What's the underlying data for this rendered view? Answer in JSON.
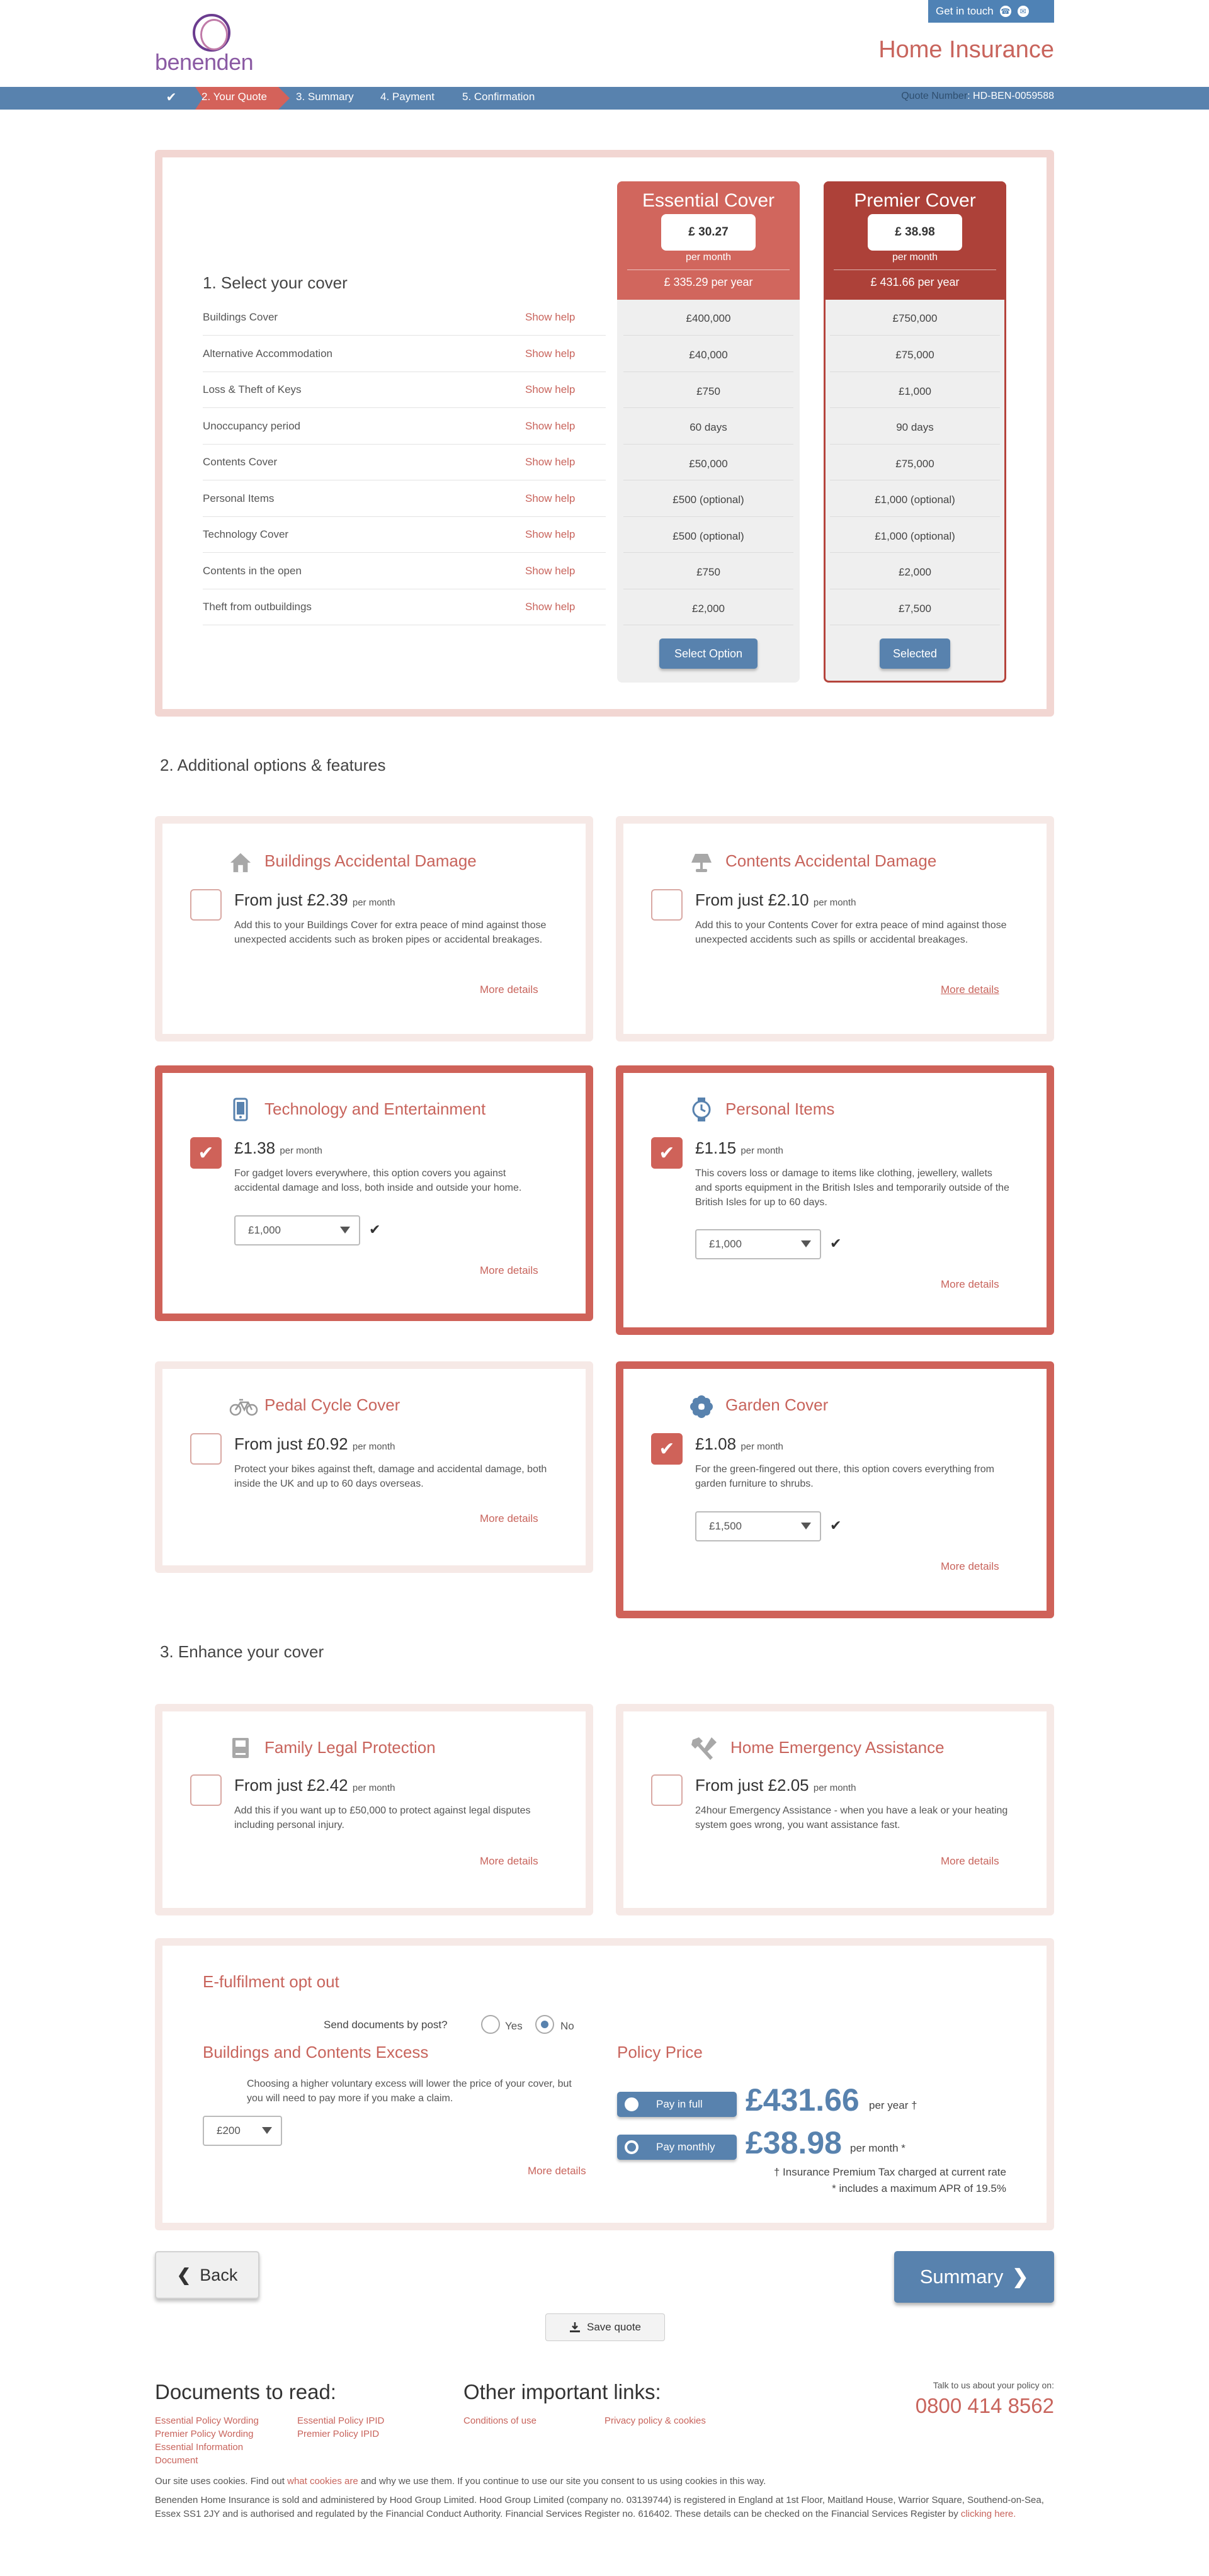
{
  "header": {
    "logo_text": "benenden",
    "get_in_touch": "Get in touch",
    "page_title": "Home Insurance",
    "steps": [
      "2. Your Quote",
      "3. Summary",
      "4. Payment",
      "5. Confirmation"
    ],
    "quote_number_label": "Quote Number",
    "quote_number": "HD-BEN-0059588"
  },
  "cover": {
    "section_title": "1. Select your cover",
    "rows": [
      {
        "label": "Buildings Cover",
        "help": "Show help",
        "essential": "£400,000",
        "premier": "£750,000"
      },
      {
        "label": "Alternative Accommodation",
        "help": "Show help",
        "essential": "£40,000",
        "premier": "£75,000"
      },
      {
        "label": "Loss & Theft of Keys",
        "help": "Show help",
        "essential": "£750",
        "premier": "£1,000"
      },
      {
        "label": "Unoccupancy period",
        "help": "Show help",
        "essential": "60 days",
        "premier": "90 days"
      },
      {
        "label": "Contents Cover",
        "help": "Show help",
        "essential": "£50,000",
        "premier": "£75,000"
      },
      {
        "label": "Personal Items",
        "help": "Show help",
        "essential": "£500 (optional)",
        "premier": "£1,000 (optional)"
      },
      {
        "label": "Technology Cover",
        "help": "Show help",
        "essential": "£500 (optional)",
        "premier": "£1,000 (optional)"
      },
      {
        "label": "Contents in the open",
        "help": "Show help",
        "essential": "£750",
        "premier": "£2,000"
      },
      {
        "label": "Theft from outbuildings",
        "help": "Show help",
        "essential": "£2,000",
        "premier": "£7,500"
      }
    ],
    "essential": {
      "title": "Essential Cover",
      "monthly": "£ 30.27",
      "per_month": "per month",
      "yearly": "£ 335.29  per year",
      "button": "Select Option"
    },
    "premier": {
      "title": "Premier Cover",
      "monthly": "£ 38.98",
      "per_month": "per month",
      "yearly": "£ 431.66  per year",
      "button": "Selected"
    }
  },
  "additional": {
    "section_title": "2. Additional options & features",
    "cards": [
      {
        "title": "Buildings Accidental Damage",
        "icon": "house-icon",
        "price": "From just £2.39",
        "per": "per month",
        "desc": "Add this to your Buildings Cover for extra peace of mind against those unexpected accidents such as broken pipes or accidental breakages.",
        "more": "More details",
        "checked": false
      },
      {
        "title": "Contents Accidental Damage",
        "icon": "lamp-icon",
        "price": "From just £2.10",
        "per": "per month",
        "desc": "Add this to your Contents Cover for extra peace of mind against those unexpected accidents such as spills or accidental breakages.",
        "more": "More details",
        "checked": false
      },
      {
        "title": "Technology and Entertainment",
        "icon": "phone-icon",
        "price": "£1.38",
        "per": "per month",
        "desc": "For gadget lovers everywhere, this option covers you against accidental damage and loss, both inside and outside your home.",
        "more": "More details",
        "checked": true,
        "select": "£1,000"
      },
      {
        "title": "Personal Items",
        "icon": "watch-icon",
        "price": "£1.15",
        "per": "per month",
        "desc": "This covers loss or damage to items like clothing, jewellery, wallets and sports equipment in the British Isles and temporarily outside of the British Isles for up to 60 days.",
        "more": "More details",
        "checked": true,
        "select": "£1,000"
      },
      {
        "title": "Pedal Cycle Cover",
        "icon": "bicycle-icon",
        "price": "From just £0.92",
        "per": "per month",
        "desc": "Protect your bikes against theft, damage and accidental damage, both inside the UK and up to 60 days overseas.",
        "more": "More details",
        "checked": false
      },
      {
        "title": "Garden Cover",
        "icon": "flower-icon",
        "price": "£1.08",
        "per": "per month",
        "desc": "For the green-fingered out there, this option covers everything from garden furniture to shrubs.",
        "more": "More details",
        "checked": true,
        "select": "£1,500"
      }
    ]
  },
  "enhance": {
    "section_title": "3. Enhance your cover",
    "cards": [
      {
        "title": "Family Legal Protection",
        "icon": "book-icon",
        "price": "From just £2.42",
        "per": "per month",
        "desc": "Add this if you want up to £50,000 to protect against legal disputes including personal injury.",
        "more": "More details"
      },
      {
        "title": "Home Emergency Assistance",
        "icon": "tools-icon",
        "price": "From just £2.05",
        "per": "per month",
        "desc": "24hour Emergency Assistance - when you have a leak or your heating system goes wrong, you want assistance fast.",
        "more": "More details"
      }
    ]
  },
  "efulfilment": {
    "title": "E-fulfilment opt out",
    "question": "Send documents by post?",
    "yes": "Yes",
    "no": "No",
    "selected": "No"
  },
  "excess": {
    "title": "Buildings and Contents Excess",
    "desc": "Choosing a higher voluntary excess will lower the price of your cover, but you will need to pay more if you make a claim.",
    "value": "£200",
    "more": "More details"
  },
  "policy_price": {
    "title": "Policy Price",
    "full_label": "Pay in full",
    "full_amount": "£431.66",
    "full_suffix": "per year †",
    "monthly_label": "Pay monthly",
    "monthly_amount": "£38.98",
    "monthly_suffix": "per month *",
    "note1": "† Insurance Premium Tax charged at current rate",
    "note2": "* includes a maximum APR of 19.5%",
    "selected": "monthly"
  },
  "actions": {
    "back": "Back",
    "summary": "Summary",
    "save": "Save quote"
  },
  "footer": {
    "docs_title": "Documents to read:",
    "docs": [
      "Essential Policy Wording",
      "Premier Policy Wording",
      "Essential Information Document",
      "Essential Policy IPID",
      "Premier Policy IPID"
    ],
    "links_title": "Other important links:",
    "links": [
      "Conditions of use",
      "Privacy policy & cookies"
    ],
    "talk": "Talk to us about your policy on:",
    "phone": "0800 414 8562",
    "cookies_pre": "Our site uses cookies. Find out ",
    "cookies_link": "what cookies are",
    "cookies_post": " and why we use them. If you continue to use our site you consent to us using cookies in this way.",
    "legal": "Benenden Home Insurance is sold and administered by Hood Group Limited. Hood Group Limited (company no. 03139744) is registered in England at 1st Floor, Maitland House, Warrior Square, Southend-on-Sea, Essex SS1 2JY and is authorised and regulated by the Financial Conduct Authority. Financial Services Register no. 616402. These details can be checked on the Financial Services Register by ",
    "legal_link": "clicking here."
  },
  "colors": {
    "brand": "#c8645c",
    "blue": "#5882ae",
    "premier": "#ad4139"
  }
}
